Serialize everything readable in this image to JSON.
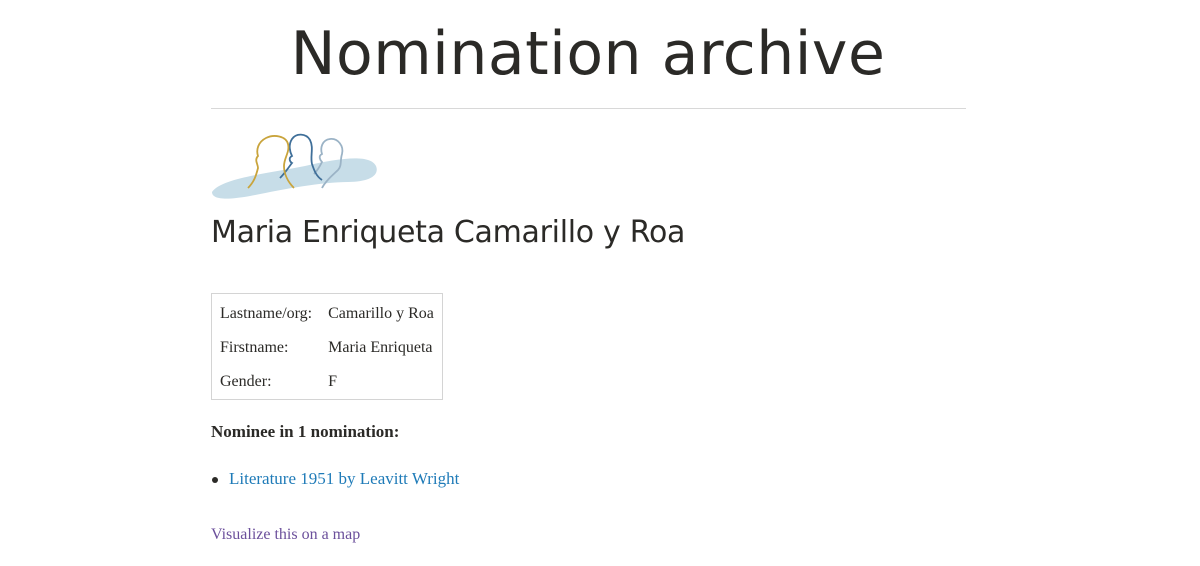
{
  "header": {
    "title": "Nomination archive"
  },
  "logo": {
    "icon": "nominees-silhouettes-logo",
    "colors": {
      "gold": "#c9a43c",
      "blue": "#3f6f99",
      "light": "#9bb3c6",
      "wave": "#c7dde8"
    }
  },
  "person": {
    "name": "Maria Enriqueta Camarillo y Roa",
    "details": [
      {
        "label": "Lastname/org:",
        "value": "Camarillo y Roa"
      },
      {
        "label": "Firstname:",
        "value": "Maria Enriqueta"
      },
      {
        "label": "Gender:",
        "value": "F"
      }
    ]
  },
  "nominations": {
    "heading": "Nominee in 1 nomination:",
    "items": [
      {
        "label": "Literature 1951 by Leavitt Wright"
      }
    ]
  },
  "map_link": {
    "label": "Visualize this on a map"
  },
  "colors": {
    "text": "#2b2a27",
    "link": "#1f7bb8",
    "visited_link": "#6b4f9b",
    "rule": "#d8d8d8"
  }
}
